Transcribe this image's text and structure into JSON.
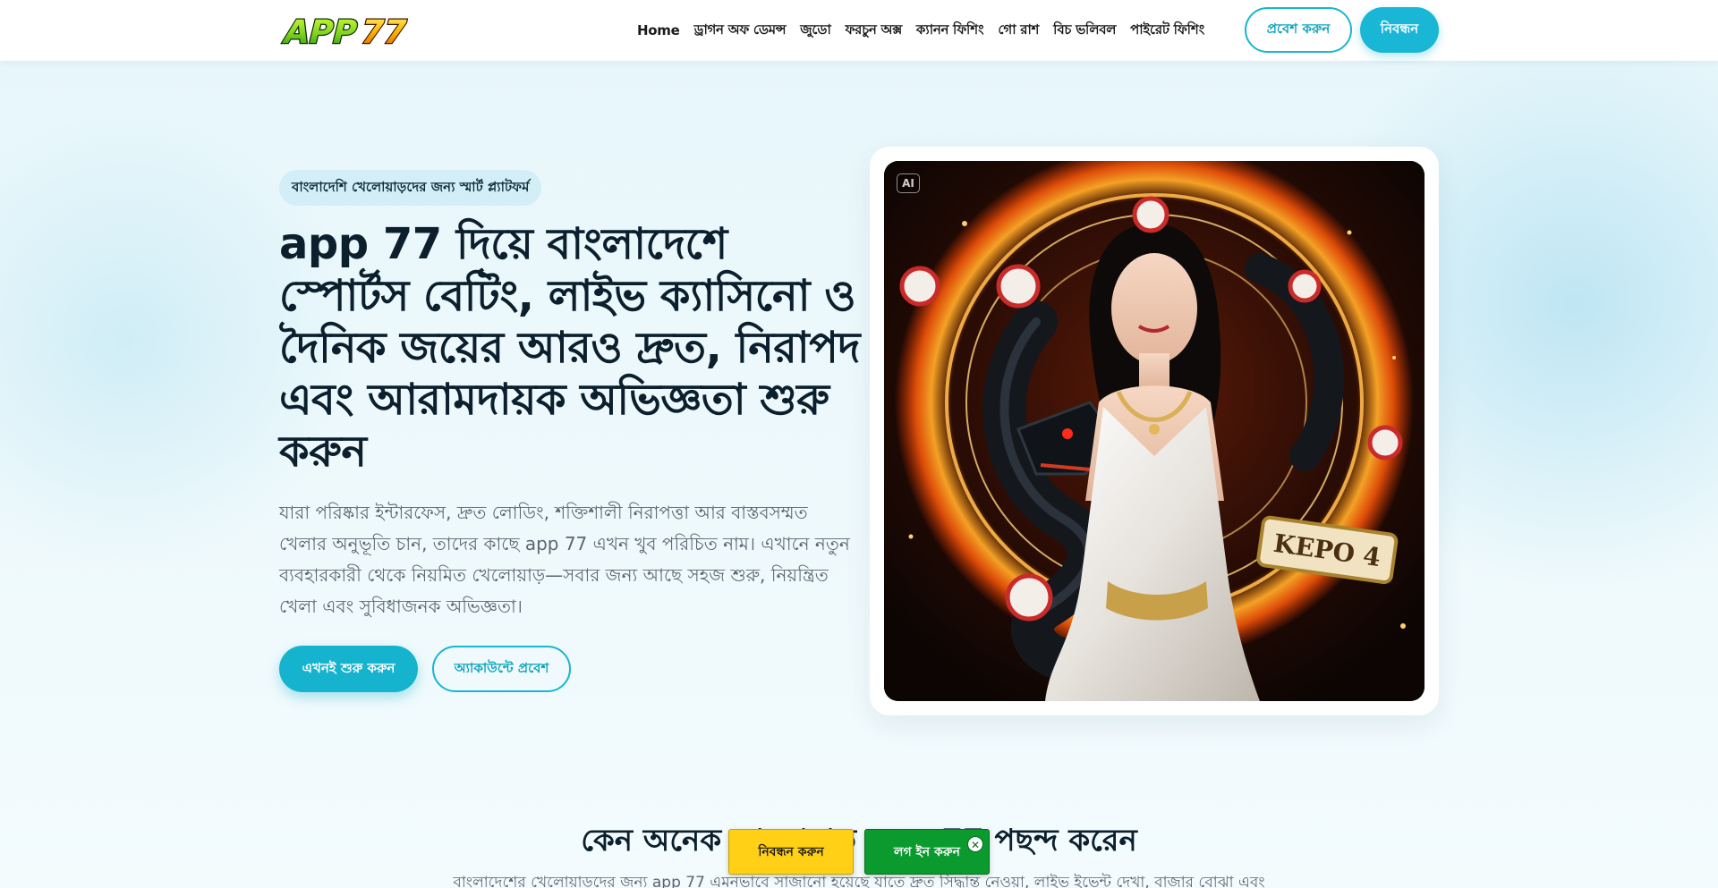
{
  "header": {
    "logo_text": "APP77",
    "nav": [
      "Home",
      "ড্রাগন অফ ডেমন্স",
      "জুডো",
      "ফরচুন অক্স",
      "ক্যানন ফিশিং",
      "গো রাশ",
      "বিচ ভলিবল",
      "পাইরেট ফিশিং"
    ],
    "login_label": "প্রবেশ করুন",
    "register_label": "নিবন্ধন"
  },
  "hero": {
    "badge": "বাংলাদেশি খেলোয়াড়দের জন্য স্মার্ট প্ল্যাটফর্ম",
    "headline": "app 77 দিয়ে বাংলাদেশে স্পোর্টস বেটিং, লাইভ ক্যাসিনো ও দৈনিক জয়ের আরও দ্রুত, নিরাপদ এবং আরামদায়ক অভিজ্ঞতা শুরু করুন",
    "lead": "যারা পরিষ্কার ইন্টারফেস, দ্রুত লোডিং, শক্তিশালী নিরাপত্তা আর বাস্তবসম্মত খেলার অনুভূতি চান, তাদের কাছে app 77 এখন খুব পরিচিত নাম। এখানে নতুন ব্যবহারকারী থেকে নিয়মিত খেলোয়াড়—সবার জন্য আছে সহজ শুরু, নিয়ন্ত্রিত খেলা এবং সুবিধাজনক অভিজ্ঞতা।",
    "cta_primary": "এখনই শুরু করুন",
    "cta_secondary": "অ্যাকাউন্টে প্রবেশ",
    "image_tag": "AI",
    "image_text": "KEPO 4"
  },
  "section": {
    "title": "কেন অনেক খেলোয়াড় app 77 পছন্দ করেন",
    "subtitle": "বাংলাদেশের খেলোয়াড়দের জন্য app 77 এমনভাবে সাজানো হয়েছে যাতে দ্রুত সিদ্ধান্ত নেওয়া, লাইভ ইভেন্ট দেখা, বাজার বোঝা এবং"
  },
  "sticky": {
    "register_label": "নিবন্ধন করুন",
    "login_label": "লগ ইন করুন",
    "close_glyph": "✕"
  },
  "colors": {
    "accent": "#1ab6d6",
    "sticky_register": "#ffd016",
    "sticky_login": "#0a9a2e"
  }
}
